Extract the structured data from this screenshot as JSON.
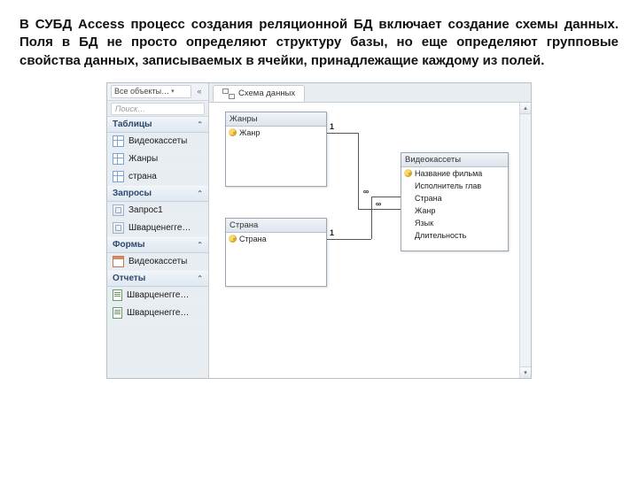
{
  "paragraph": "В СУБД Access процесс создания реляционной БД включает создание схемы данных. Поля в БД не просто определяют структуру базы, но еще определяют групповые свойства данных, записываемых в ячейки, принадлежащие каждому из полей.",
  "nav": {
    "dropdown_label": "Все объекты…",
    "search_placeholder": "Поиск…",
    "groups": {
      "tables": "Таблицы",
      "queries": "Запросы",
      "forms": "Формы",
      "reports": "Отчеты"
    },
    "tables": [
      "Видеокассеты",
      "Жанры",
      "страна"
    ],
    "queries": [
      "Запрос1",
      "Шварценегге…"
    ],
    "forms": [
      "Видеокассеты"
    ],
    "reports": [
      "Шварценегге…",
      "Шварценегге…"
    ]
  },
  "tab_title": "Схема данных",
  "boxes": {
    "genre": {
      "title": "Жанры",
      "fields": [
        "Жанр"
      ]
    },
    "country": {
      "title": "Страна",
      "fields": [
        "Страна"
      ]
    },
    "video": {
      "title": "Видеокассеты",
      "fields": [
        "Название фильма",
        "Исполнитель глав",
        "Страна",
        "Жанр",
        "Язык",
        "Длительность"
      ]
    }
  },
  "rel_labels": {
    "one": "1",
    "many": "∞"
  }
}
